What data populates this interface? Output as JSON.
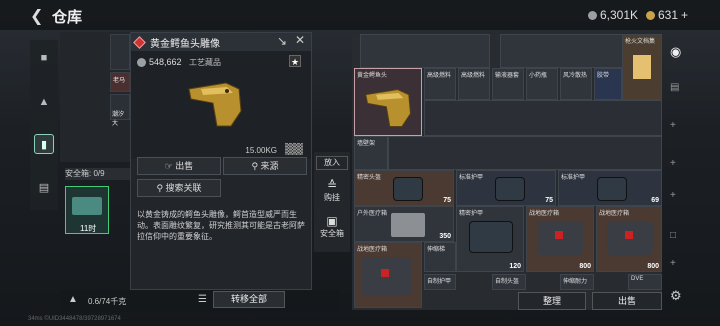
{
  "header": {
    "back_icon": "back-arrow",
    "title": "仓库",
    "silver": "6,301K",
    "gold": "631"
  },
  "currency_colors": {
    "silver": "#9aa0a6",
    "gold": "#c9a24a"
  },
  "detail": {
    "name": "黄金鳄鱼头雕像",
    "price": "548,662",
    "category": "工艺藏品",
    "weight": "15.00KG",
    "sell_label": "出售",
    "source_label": "来源",
    "search_label": "搜索关联",
    "description": "以黄金铸成的鳄鱼头雕像，鳄首造型威严而生动。表面雕纹繁复，研究推测其可能是古老阿萨拉信仰中的重要象征。"
  },
  "left": {
    "secure_label": "安全箱: 0/9",
    "secure_time": "11时",
    "partial_label": "老马",
    "partial_label2": "潮汐大"
  },
  "side_options": {
    "place_label": "放入",
    "hang_label": "购挂",
    "safe_label": "安全箱"
  },
  "bottom": {
    "capacity": "0.6/74千克",
    "move_all": "转移全部"
  },
  "footer": "34ms  ©UID3448478/39728971674",
  "warehouse": {
    "top_label": "枪火文档集",
    "items": [
      {
        "name": "黄金鳄鱼头"
      },
      {
        "name": "高级燃料"
      },
      {
        "name": "高级燃料"
      },
      {
        "name": "输液器套"
      },
      {
        "name": "小药瓶"
      },
      {
        "name": "风冷散热"
      },
      {
        "name": "胶带"
      },
      {
        "name": "墙壁架"
      },
      {
        "name": "精密头盔",
        "qty": "75"
      },
      {
        "name": "标准护甲",
        "qty": "75"
      },
      {
        "name": "标准护甲",
        "qty": "69"
      },
      {
        "name": "户外医疗箱",
        "qty": "350"
      },
      {
        "name": "精密护甲",
        "qty": "120"
      },
      {
        "name": "战地医疗箱",
        "qty": "800"
      },
      {
        "name": "战地医疗箱",
        "qty": "800"
      },
      {
        "name": "战地医疗箱"
      },
      {
        "name": "伸缩梯"
      },
      {
        "name": "自制护甲"
      },
      {
        "name": "自制头盔"
      },
      {
        "name": "伸缩耐力"
      },
      {
        "name": "DVE"
      }
    ],
    "sort_label": "整理",
    "sell_label": "出售"
  }
}
